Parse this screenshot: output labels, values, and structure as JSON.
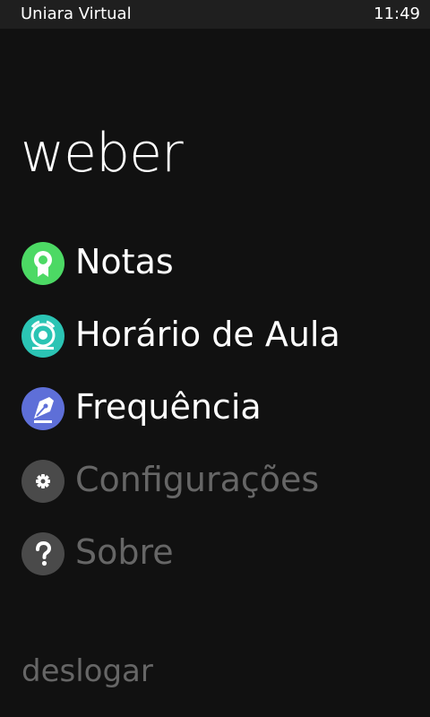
{
  "status_bar": {
    "app_name": "Uniara Virtual",
    "time": "11:49"
  },
  "header": {
    "title": "weber"
  },
  "menu": {
    "items": [
      {
        "label": "Notas",
        "icon": "award-icon",
        "color": "#4cd964",
        "enabled": true
      },
      {
        "label": "Horário de Aula",
        "icon": "bell-icon",
        "color": "#2bc4b4",
        "enabled": true
      },
      {
        "label": "Frequência",
        "icon": "pen-nib-icon",
        "color": "#5e6fd8",
        "enabled": true
      },
      {
        "label": "Configurações",
        "icon": "gear-icon",
        "color": "#4a4a4a",
        "enabled": false
      },
      {
        "label": "Sobre",
        "icon": "question-icon",
        "color": "#4a4a4a",
        "enabled": false
      }
    ]
  },
  "footer": {
    "logout_label": "deslogar"
  },
  "colors": {
    "background": "#111111",
    "status_bar": "#1f1f1f",
    "text": "#ffffff",
    "disabled_text": "#666666"
  }
}
